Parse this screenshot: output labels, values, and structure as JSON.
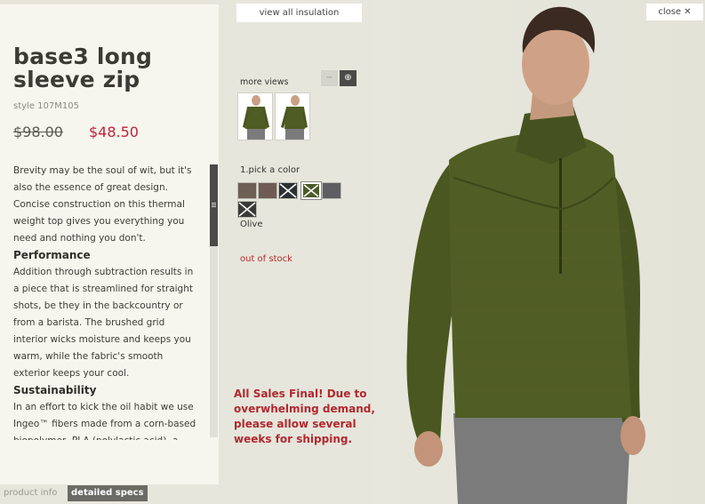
{
  "product": {
    "title": "base3 long sleeve zip",
    "style": "style 107M105",
    "price_original": "$98.00",
    "price_sale": "$48.50"
  },
  "description": {
    "intro": "Brevity may be the soul of wit, but it's also the essence of great design. Concise construction on this thermal weight top gives you everything you need and nothing you don't.",
    "sections": [
      {
        "heading": "Performance",
        "body": "Addition through subtraction results in a piece that is streamlined for straight shots, be they in the backcountry or from a barista. The brushed grid interior wicks moisture and keeps you warm, while the fabric's smooth exterior keeps your cool."
      },
      {
        "heading": "Sustainability",
        "body": "In an effort to kick the oil habit we use Ingeo™ fibers made from a corn-based biopolymer, PLA (polylactic acid), a"
      }
    ]
  },
  "tabs": {
    "product_info": "product info",
    "detailed_specs": "detailed specs"
  },
  "toolbar": {
    "view_all": "view all insulation",
    "close": "close ✕"
  },
  "views": {
    "label": "more views",
    "zoom_out_icon": "−",
    "zoom_in_icon": "⊕"
  },
  "color": {
    "label": "1.pick a color",
    "selected": "Olive",
    "swatches": [
      {
        "color": "#6e5f55",
        "available": true
      },
      {
        "color": "#6d5b54",
        "available": true
      },
      {
        "color": "#2c3034",
        "available": false
      },
      {
        "color": "#4c5a2a",
        "available": false
      },
      {
        "color": "#5e5e62",
        "available": true
      },
      {
        "color": "#3a3a36",
        "available": false
      }
    ]
  },
  "stock_status": "out of stock",
  "notice": "All Sales Final! Due to overwhelming demand, please allow several weeks for shipping.",
  "colors": {
    "accent_red": "#c0223a",
    "panel_bg": "#f7f6ee",
    "jacket_olive": "#4c5a22"
  }
}
